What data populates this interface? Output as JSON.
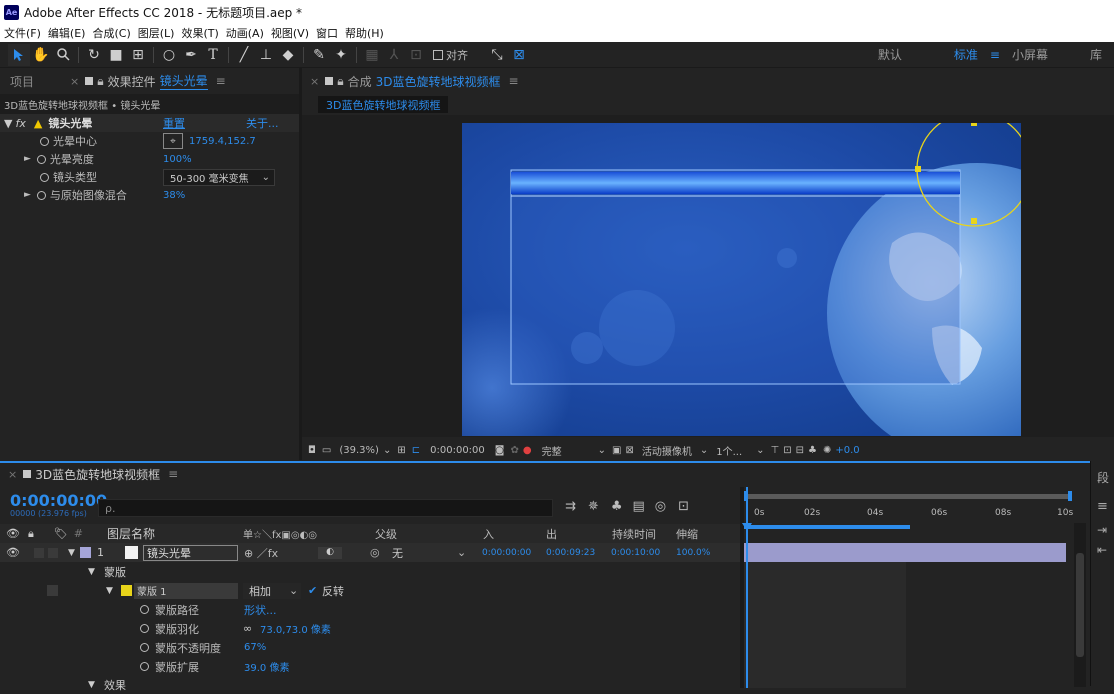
{
  "window": {
    "title": "Adobe After Effects CC 2018 - 无标题项目.aep *",
    "logo": "Ae"
  },
  "menu": [
    "文件(F)",
    "编辑(E)",
    "合成(C)",
    "图层(L)",
    "效果(T)",
    "动画(A)",
    "视图(V)",
    "窗口",
    "帮助(H)"
  ],
  "toolbar": {
    "align_label": "对齐",
    "workspaces": [
      {
        "label": "默认",
        "active": false
      },
      {
        "label": "标准",
        "active": true
      },
      {
        "label": "小屏幕",
        "active": false
      },
      {
        "label": "库",
        "active": false
      }
    ],
    "ws_menu_icon": "≡"
  },
  "left_panel": {
    "tab_project": "项目",
    "tab_effects_prefix": "效果控件",
    "tab_effects_layer": "镜头光晕",
    "menu_icon": "≡",
    "breadcrumb": "3D蓝色旋转地球视频框 • 镜头光晕",
    "effect": {
      "fx": "fx",
      "name": "镜头光晕",
      "reset": "重置",
      "about": "关于..."
    },
    "props": [
      {
        "name": "光晕中心",
        "value": "1759.4,152.7",
        "type": "point"
      },
      {
        "name": "光晕亮度",
        "value": "100%",
        "type": "value",
        "expand": true
      },
      {
        "name": "镜头类型",
        "value": "50-300 毫米变焦",
        "type": "select"
      },
      {
        "name": "与原始图像混合",
        "value": "38%",
        "type": "value",
        "expand": true
      }
    ]
  },
  "comp_panel": {
    "tab_prefix": "合成",
    "tab_name": "3D蓝色旋转地球视频框",
    "menu_icon": "≡",
    "subtab": "3D蓝色旋转地球视频框",
    "footer": {
      "zoom": "(39.3%)",
      "timecode": "0:00:00:00",
      "quality": "完整",
      "camera": "活动摄像机",
      "views": "1个...",
      "exposure": "+0.0"
    }
  },
  "timeline": {
    "tab_name": "3D蓝色旋转地球视频框",
    "menu_icon": "≡",
    "timecode": "0:00:00:00",
    "fps": "00000 (23.976 fps)",
    "search_placeholder": "ρ.",
    "headers": {
      "layer_name": "图层名称",
      "switches": "单☆＼fx▣◎◐◎",
      "parent": "父级",
      "in": "入",
      "out": "出",
      "duration": "持续时间",
      "stretch": "伸缩"
    },
    "layer": {
      "num": "1",
      "name": "镜头光晕",
      "parent": "无",
      "in": "0:00:00:00",
      "out": "0:00:09:23",
      "duration": "0:00:10:00",
      "stretch": "100.0%"
    },
    "masks_group": "蒙版",
    "mask": {
      "name": "蒙版 1",
      "mode": "相加",
      "inverted_label": "反转"
    },
    "mask_props": [
      {
        "name": "蒙版路径",
        "value": "形状..."
      },
      {
        "name": "蒙版羽化",
        "value": "73.0,73.0 像素"
      },
      {
        "name": "蒙版不透明度",
        "value": "67%"
      },
      {
        "name": "蒙版扩展",
        "value": "39.0 像素"
      }
    ],
    "effects_group": "效果",
    "ruler": [
      "0s",
      "02s",
      "04s",
      "06s",
      "08s",
      "10s"
    ]
  },
  "colors": {
    "accent": "#2d8ceb",
    "bg": "#232323",
    "panel": "#1d1d1d",
    "bar": "#9b9bcc",
    "mask_yellow": "#e8d41a",
    "label_purple": "#a5a5d8"
  },
  "icons": {
    "arrow": "selection-tool-icon",
    "hand": "hand-tool-icon",
    "zoom": "zoom-tool-icon",
    "eye": "eye-icon",
    "stopwatch": "stopwatch-icon"
  }
}
